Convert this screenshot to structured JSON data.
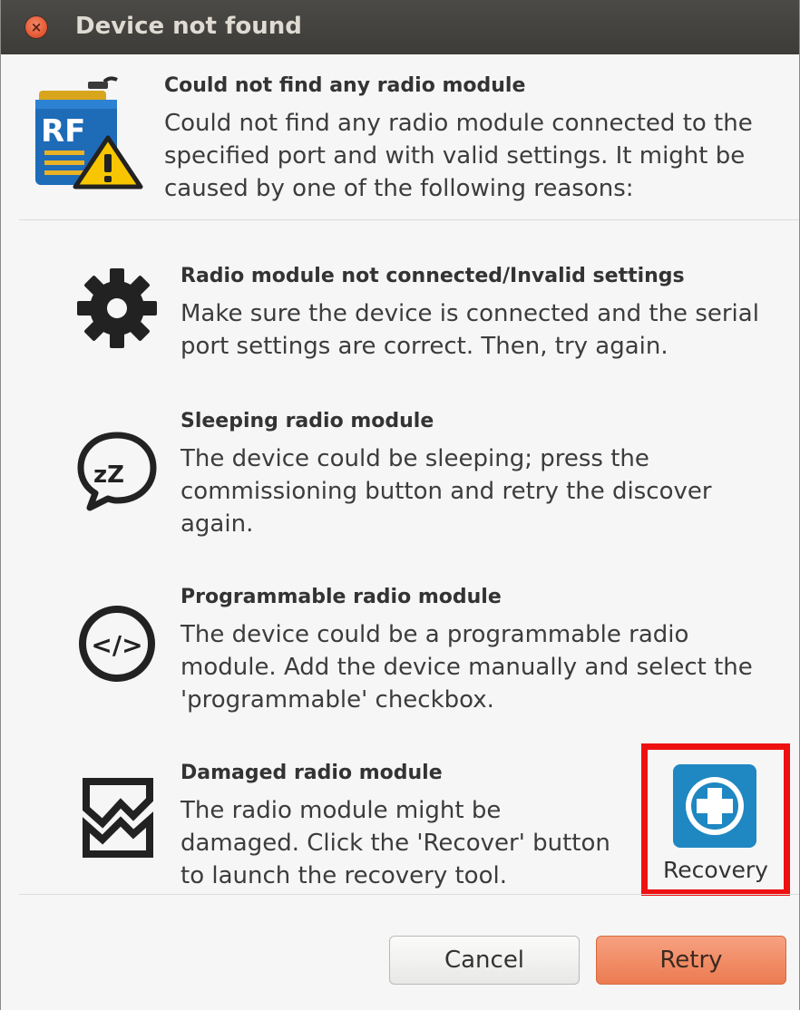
{
  "window": {
    "title": "Device not found",
    "close_icon": "×"
  },
  "header": {
    "icon": "rf-module-warning-icon",
    "icon_text": "RF",
    "title": "Could not find any radio module",
    "text": "Could not find any radio module connected to the specified port and with valid settings. It might be caused by one of the following reasons:"
  },
  "reasons": [
    {
      "icon": "gear-icon",
      "title": "Radio module not connected/Invalid settings",
      "text": "Make sure the device is connected and the serial port settings are correct. Then, try again."
    },
    {
      "icon": "sleep-bubble-icon",
      "icon_text": "zZ",
      "title": "Sleeping radio module",
      "text": "The device could be sleeping; press the commissioning button and retry the discover again."
    },
    {
      "icon": "code-icon",
      "icon_text": "</>",
      "title": "Programmable radio module",
      "text": "The device could be a programmable radio module. Add the device manually and select the 'programmable' checkbox."
    },
    {
      "icon": "damaged-module-icon",
      "title": "Damaged radio module",
      "text": "The radio module might be damaged. Click the 'Recover' button to launch the recovery tool."
    }
  ],
  "recovery": {
    "label": "Recovery",
    "icon": "recovery-plus-icon"
  },
  "buttons": {
    "cancel": "Cancel",
    "retry": "Retry"
  },
  "colors": {
    "titlebar": "#3d3c38",
    "accent": "#ec7b51",
    "highlight": "#ee1111",
    "recovery_icon": "#1f87c1"
  }
}
